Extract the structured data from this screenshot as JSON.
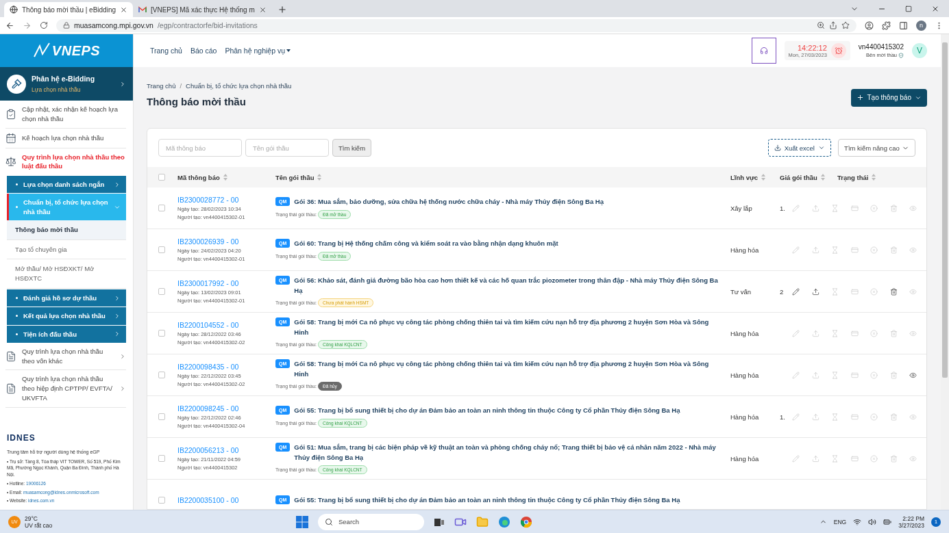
{
  "browser": {
    "tabs": [
      {
        "title": "Thông báo mời thầu | eBidding",
        "selected": true
      },
      {
        "title": "[VNEPS] Mã xác thực Hệ thống m",
        "selected": false
      }
    ],
    "url_host": "muasamcong.mpi.gov.vn",
    "url_path": "/egp/contractorfe/bid-invitations",
    "profile": "n"
  },
  "logo": "VNEPS",
  "nav": [
    {
      "label": "Trang chủ",
      "dropdown": false
    },
    {
      "label": "Báo cáo",
      "dropdown": false
    },
    {
      "label": "Phân hệ nghiệp vụ",
      "dropdown": true
    }
  ],
  "header": {
    "time": "14:22:12",
    "date": "Mon, 27/03/2023",
    "user": "vn4400415302",
    "role": "Bên mời thầu",
    "avatar": "V"
  },
  "module": {
    "title": "Phân hệ e-Bidding",
    "subtitle": "Lựa chọn nhà thầu"
  },
  "sidebar": {
    "items": [
      {
        "label": "Cập nhật, xác nhận kế hoạch lựa chọn nhà thầu",
        "active": false
      },
      {
        "label": "Kế hoạch lựa chọn nhà thầu",
        "active": false
      },
      {
        "label": "Quy trình lựa chọn nhà thầu theo luật đấu thầu",
        "active": true,
        "expanded": true,
        "children": [
          {
            "label": "Lựa chọn danh sách ngắn",
            "expanded": false
          },
          {
            "label": "Chuẩn bị, tổ chức lựa chọn nhà thầu",
            "expanded": true,
            "children": [
              {
                "label": "Thông báo mời thầu",
                "selected": true
              },
              {
                "label": "Tạo tổ chuyên gia",
                "selected": false
              },
              {
                "label": "Mở thầu/ Mở HSĐXKT/ Mở HSĐXTC",
                "selected": false
              }
            ]
          },
          {
            "label": "Đánh giá hồ sơ dự thầu",
            "expanded": false
          },
          {
            "label": "Kết quả lựa chọn nhà thầu",
            "expanded": false
          },
          {
            "label": "Tiện ích đấu thầu",
            "expanded": false
          }
        ]
      },
      {
        "label": "Quy trình lựa chọn nhà thầu theo vốn khác",
        "active": false,
        "expanded": false
      },
      {
        "label": "Quy trình lựa chọn nhà thầu theo hiệp định CPTPP/ EVFTA/ UKVFTA",
        "active": false,
        "expanded": false
      }
    ]
  },
  "support": {
    "logo": "IDNES",
    "title": "Trung tâm hỗ trợ người dùng hệ thống eGP",
    "lines": [
      {
        "label": "• Trụ sở:",
        "value": "Tầng 8, Tòa tháp VIT TOWER, Số 519, Phố Kim Mã, Phường Ngọc Khánh, Quận Ba Đình, Thành phố Hà Nội.",
        "link": false
      },
      {
        "label": "• Hotline:",
        "value": "19006126",
        "link": true
      },
      {
        "label": "• Email:",
        "value": "muasamcong@idnes.onmicrosoft.com",
        "link": true
      },
      {
        "label": "• Website:",
        "value": "idnes.com.vn",
        "link": true
      }
    ]
  },
  "breadcrumb": [
    "Trang chủ",
    "Chuẩn bị, tổ chức lựa chọn nhà thầu"
  ],
  "breadcrumb_separator": "/",
  "page_title": "Thông báo mời thầu",
  "create_button": "Tạo thông báo",
  "filters": {
    "code_placeholder": "Mã thông báo",
    "name_placeholder": "Tên gói thầu",
    "search": "Tìm kiếm",
    "export": "Xuất excel",
    "advanced": "Tìm kiếm nâng cao"
  },
  "table": {
    "select_all_checked": false,
    "columns": [
      "Mã thông báo",
      "Tên gói thầu",
      "Lĩnh vực",
      "Giá gói thầu",
      "Trạng thái"
    ],
    "rows": [
      {
        "checked": false,
        "code": "IB2300028772 - 00",
        "created": "Ngày tạo: 28/02/2023 10:34",
        "creator": "Người tạo: vn4400415302-01",
        "badge": "QM",
        "title": "Gói 36: Mua sắm, bảo dưỡng, sửa chữa hệ thống nước chữa cháy - Nhà máy Thủy điện Sông Ba Hạ",
        "status_label": "Trạng thái gói thầu:",
        "status": {
          "text": "Đã mở thầu",
          "kind": "success"
        },
        "field": "Xây lắp",
        "price": "1.",
        "actions": [
          {
            "kind": "edit",
            "enabled": false
          },
          {
            "kind": "upload",
            "enabled": false
          },
          {
            "kind": "timer",
            "enabled": false
          },
          {
            "kind": "card",
            "enabled": false
          },
          {
            "kind": "cancel",
            "enabled": false
          },
          {
            "kind": "delete",
            "enabled": false
          },
          {
            "kind": "view",
            "enabled": false
          }
        ]
      },
      {
        "checked": false,
        "code": "IB2300026939 - 00",
        "created": "Ngày tạo: 24/02/2023 04:20",
        "creator": "Người tạo: vn4400415302-01",
        "badge": "QM",
        "title": "Gói 60: Trang bị Hệ thống chấm công và kiểm soát ra vào bằng nhận dạng khuôn mặt",
        "status_label": "Trạng thái gói thầu:",
        "status": {
          "text": "Đã mở thầu",
          "kind": "success"
        },
        "field": "Hàng hóa",
        "actions": [
          {
            "kind": "edit",
            "enabled": false
          },
          {
            "kind": "upload",
            "enabled": false
          },
          {
            "kind": "timer",
            "enabled": false
          },
          {
            "kind": "card",
            "enabled": false
          },
          {
            "kind": "cancel",
            "enabled": false
          },
          {
            "kind": "delete",
            "enabled": false
          },
          {
            "kind": "view",
            "enabled": false
          }
        ]
      },
      {
        "checked": false,
        "code": "IB2300017992 - 00",
        "created": "Ngày tạo: 13/02/2023 09:01",
        "creator": "Người tạo: vn4400415302-01",
        "badge": "QM",
        "title": "Gói 56: Khảo sát, đánh giá đường bão hòa cao hơn thiết kế và các hố quan trắc piozometer trong thân đập - Nhà máy Thủy điện Sông Ba Hạ",
        "status_label": "Trạng thái gói thầu:",
        "status": {
          "text": "Chưa phát hành HSMT",
          "kind": "warning"
        },
        "field": "Tư vấn",
        "price": "2",
        "actions": [
          {
            "kind": "edit",
            "enabled": true
          },
          {
            "kind": "upload",
            "enabled": true
          },
          {
            "kind": "timer",
            "enabled": false
          },
          {
            "kind": "card",
            "enabled": false
          },
          {
            "kind": "cancel",
            "enabled": false
          },
          {
            "kind": "delete",
            "enabled": true
          },
          {
            "kind": "view",
            "enabled": false
          }
        ]
      },
      {
        "checked": false,
        "code": "IB2200104552 - 00",
        "created": "Ngày tạo: 28/12/2022 03:46",
        "creator": "Người tạo: vn4400415302-02",
        "badge": "QM",
        "title": "Gói 58: Trang bị mới Ca nô phục vụ công tác phòng chống thiên tai và tìm kiếm cứu nạn hỗ trợ địa phương 2 huyện Sơn Hòa và Sông Hinh",
        "status_label": "Trạng thái gói thầu:",
        "status": {
          "text": "Công khai KQLCNT",
          "kind": "success"
        },
        "field": "Hàng hóa",
        "actions": [
          {
            "kind": "edit",
            "enabled": false
          },
          {
            "kind": "upload",
            "enabled": false
          },
          {
            "kind": "timer",
            "enabled": false
          },
          {
            "kind": "card",
            "enabled": false
          },
          {
            "kind": "cancel",
            "enabled": false
          },
          {
            "kind": "delete",
            "enabled": false
          },
          {
            "kind": "view",
            "enabled": false
          }
        ]
      },
      {
        "checked": false,
        "code": "IB2200098435 - 00",
        "created": "Ngày tạo: 22/12/2022 03:45",
        "creator": "Người tạo: vn4400415302-02",
        "badge": "QM",
        "title": "Gói 58: Trang bị mới Ca nô phục vụ công tác phòng chống thiên tai và tìm kiếm cứu nạn hỗ trợ địa phương 2 huyện Sơn Hòa và Sông Hinh",
        "status_label": "Trạng thái gói thầu:",
        "status": {
          "text": "Đã hủy",
          "kind": "cancelled"
        },
        "field": "Hàng hóa",
        "actions": [
          {
            "kind": "edit",
            "enabled": false
          },
          {
            "kind": "upload",
            "enabled": false
          },
          {
            "kind": "timer",
            "enabled": false
          },
          {
            "kind": "card",
            "enabled": false
          },
          {
            "kind": "cancel",
            "enabled": false
          },
          {
            "kind": "delete",
            "enabled": false
          },
          {
            "kind": "view",
            "enabled": true
          }
        ]
      },
      {
        "checked": false,
        "code": "IB2200098245 - 00",
        "created": "Ngày tạo: 22/12/2022 02:46",
        "creator": "Người tạo: vn4400415302-04",
        "badge": "QM",
        "title": "Gói 55: Trang bị bổ sung thiết bị cho dự án Đảm bảo an toàn an ninh thông tin thuộc Công ty Cổ phần Thủy điện Sông Ba Hạ",
        "status_label": "Trạng thái gói thầu:",
        "status": {
          "text": "Công khai KQLCNT",
          "kind": "success"
        },
        "field": "Hàng hóa",
        "price": "1.",
        "actions": [
          {
            "kind": "edit",
            "enabled": false
          },
          {
            "kind": "upload",
            "enabled": false
          },
          {
            "kind": "timer",
            "enabled": false
          },
          {
            "kind": "card",
            "enabled": false
          },
          {
            "kind": "cancel",
            "enabled": false
          },
          {
            "kind": "delete",
            "enabled": false
          },
          {
            "kind": "view",
            "enabled": false
          }
        ]
      },
      {
        "checked": false,
        "code": "IB2200056213 - 00",
        "created": "Ngày tạo: 21/11/2022 04:59",
        "creator": "Người tạo: vn4400415302",
        "badge": "QM",
        "title": "Gói 51: Mua sắm, trang bị các biện pháp về kỹ thuật an toàn và phòng chống cháy nổ; Trang thiết bị bảo vệ cá nhân năm 2022 - Nhà máy Thủy điện Sông Ba Hạ",
        "status_label": "Trạng thái gói thầu:",
        "status": {
          "text": "Công khai KQLCNT",
          "kind": "success"
        },
        "field": "Hàng hóa",
        "actions": [
          {
            "kind": "edit",
            "enabled": false
          },
          {
            "kind": "upload",
            "enabled": false
          },
          {
            "kind": "timer",
            "enabled": false
          },
          {
            "kind": "card",
            "enabled": false
          },
          {
            "kind": "cancel",
            "enabled": false
          },
          {
            "kind": "delete",
            "enabled": false
          },
          {
            "kind": "view",
            "enabled": false
          }
        ]
      },
      {
        "checked": false,
        "code": "IB2200035100 - 00",
        "badge": "QM",
        "title": "Gói 55: Trang bị bổ sung thiết bị cho dự án Đảm bảo an toàn an ninh thông tin thuộc Công ty Cổ phần Thủy điện Sông Ba Hạ"
      }
    ]
  },
  "taskbar": {
    "temperature": "29°C",
    "weather": "UV rất cao",
    "uv": "UV",
    "search_placeholder": "Search",
    "language": "ENG",
    "time": "2:22 PM",
    "date": "3/27/2023",
    "notifications": "1"
  }
}
